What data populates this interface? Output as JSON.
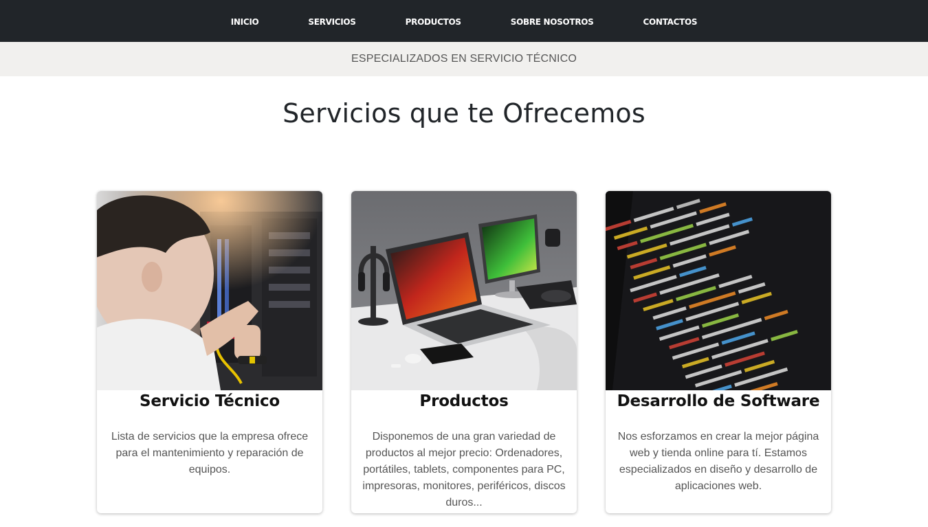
{
  "nav": {
    "items": [
      {
        "label": "INICIO"
      },
      {
        "label": "SERVICIOS"
      },
      {
        "label": "PRODUCTOS"
      },
      {
        "label": "SOBRE NOSOTROS"
      },
      {
        "label": "CONTACTOS"
      }
    ]
  },
  "tagline": "ESPECIALIZADOS EN SERVICIO TÉCNICO",
  "section": {
    "title": "Servicios que te Ofrecemos"
  },
  "cards": [
    {
      "title": "Servicio Técnico",
      "text": "Lista de servicios que la empresa ofrece para el mantenimiento y reparación de equipos.",
      "image": "technician-repairing-computer-photo"
    },
    {
      "title": "Productos",
      "text": "Disponemos de una gran variedad de productos al mejor precio: Ordenadores, portátiles, tablets, componentes para PC, impresoras, monitores, periféricos, discos duros...",
      "image": "laptop-and-tablet-desk-photo"
    },
    {
      "title": "Desarrollo de Software",
      "text": "Nos esforzamos en crear la mejor página web y tienda online para tí. Estamos especializados en diseño y desarrollo de aplicaciones web.",
      "image": "source-code-screen-photo"
    }
  ],
  "colors": {
    "navbar_bg": "#212529",
    "tagline_bg": "#f1f0ee",
    "text_muted": "#555555"
  }
}
